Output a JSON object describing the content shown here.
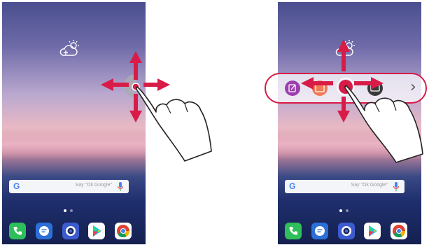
{
  "screens": [
    {
      "id": "left",
      "search": {
        "logo": "G",
        "hint": "Say \"Ok Google\""
      },
      "dock_apps": [
        "phone-icon",
        "messages-icon",
        "camera-icon",
        "play-store-icon",
        "chrome-icon"
      ]
    },
    {
      "id": "right",
      "search": {
        "logo": "G",
        "hint": "Say \"Ok Google\""
      },
      "dock_apps": [
        "phone-icon",
        "messages-icon",
        "camera-icon",
        "play-store-icon",
        "chrome-icon"
      ],
      "floating_bar": {
        "items": [
          "memo-icon",
          "screenshot-icon",
          "floating-handle",
          "capture-icon",
          "chevron-right-icon"
        ],
        "chevron": "›"
      }
    }
  ],
  "colors": {
    "arrow": "#d81b47",
    "phone_app": "#2fbf5a",
    "messages_app": "#2c6fd8",
    "camera_app": "#3d5bd0"
  }
}
